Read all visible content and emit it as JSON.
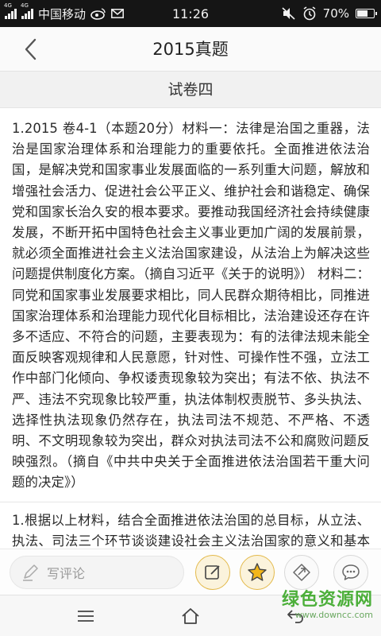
{
  "status_bar": {
    "signal_label_1": "4G",
    "signal_label_2": "4G",
    "carrier": "中国移动",
    "time": "11:26",
    "battery_percent_text": "70%",
    "battery_level": 0.7
  },
  "header": {
    "title": "2015真题"
  },
  "section": {
    "title": "试卷四"
  },
  "question": {
    "text": "1.2015 卷4-1（本题20分）材料一：法律是治国之重器，法治是国家治理体系和治理能力的重要依托。全面推进依法治国，是解决党和国家事业发展面临的一系列重大问题，解放和增强社会活力、促进社会公平正义、维护社会和谐稳定、确保党和国家长治久安的根本要求。要推动我国经济社会持续健康发展，不断开拓中国特色社会主义事业更加广阔的发展前景，就必须全面推进社会主义法治国家建设，从法治上为解决这些问题提供制度化方案。（摘自习近平《关于的说明》） 材料二：同党和国家事业发展要求相比，同人民群众期待相比，同推进国家治理体系和治理能力现代化目标相比，法治建设还存在许多不适应、不符合的问题，主要表现为：有的法律法规未能全面反映客观规律和人民意愿，针对性、可操作性不强，立法工作中部门化倾向、争权诿责现象较为突出；有法不依、执法不严、违法不究现象比较严重，执法体制权责脱节、多头执法、选择性执法现象仍然存在，执法司法不规范、不严格、不透明、不文明现象较为突出，群众对执法司法不公和腐败问题反映强烈。（摘自《中共中央关于全面推进依法治国若干重大问题的决定》）"
  },
  "sub_question": {
    "text": "1.根据以上材料，结合全面推进依法治国的总目标，从立法、执法、司法三个环节谈谈建设社会主义法治国家的意义和基本要求。"
  },
  "action_bar": {
    "comment_placeholder": "写评论",
    "icons": [
      "pencil-icon",
      "edit-note-icon",
      "star-icon",
      "share-icon",
      "chat-icon"
    ],
    "colors": {
      "gold_accent": "#e3b94a",
      "gold_fill": "#f2b61a"
    }
  },
  "nav_bar": {
    "icons": [
      "menu-icon",
      "home-icon",
      "back-arrow-icon"
    ]
  },
  "watermark": {
    "main": "绿色资源网",
    "sub": "www.downcc.com",
    "color": "#4caf3a"
  }
}
